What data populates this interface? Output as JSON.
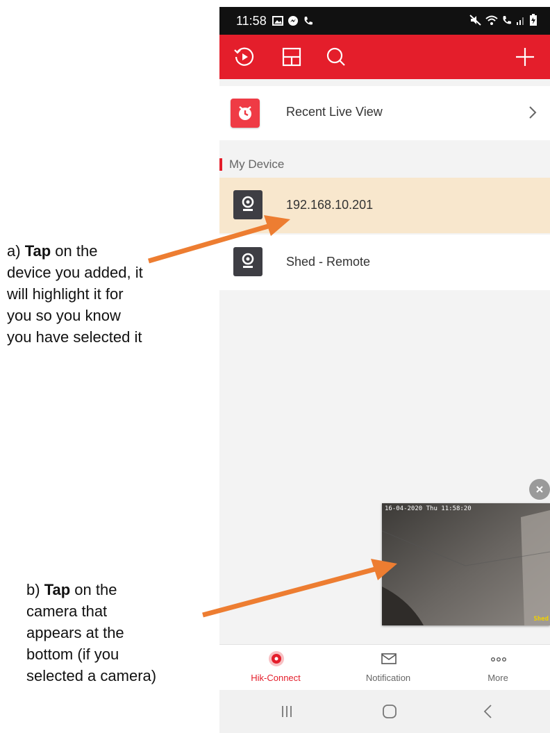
{
  "status_bar": {
    "time": "11:58"
  },
  "app_bar": {
    "icons": [
      "playback-icon",
      "layout-icon",
      "search-icon",
      "add-icon"
    ]
  },
  "recent": {
    "label": "Recent Live View",
    "icon": "clock-icon"
  },
  "my_device": {
    "header": "My Device",
    "devices": [
      {
        "label": "192.168.10.201",
        "selected": true,
        "icon": "camera-icon"
      },
      {
        "label": "Shed - Remote",
        "selected": false,
        "icon": "camera-icon"
      }
    ]
  },
  "preview": {
    "timestamp": "16-04-2020 Thu 11:58:20",
    "channel_tag": "Shed"
  },
  "tabs": [
    {
      "label": "Hik-Connect",
      "active": true,
      "icon": "hik-connect-icon"
    },
    {
      "label": "Notification",
      "active": false,
      "icon": "envelope-icon"
    },
    {
      "label": "More",
      "active": false,
      "icon": "more-dots-icon"
    }
  ],
  "annotations": {
    "a": {
      "prefix": "a) ",
      "bold": "Tap",
      "rest": " on the device you added, it will highlight it for you so you know you have selected it"
    },
    "b": {
      "prefix": "b) ",
      "bold": "Tap",
      "rest": " on the camera that appears at the bottom (if you selected a camera)"
    }
  },
  "colors": {
    "accent": "#e41e2b",
    "selected_row": "#f8e7cd",
    "arrow": "#ed7d31"
  }
}
